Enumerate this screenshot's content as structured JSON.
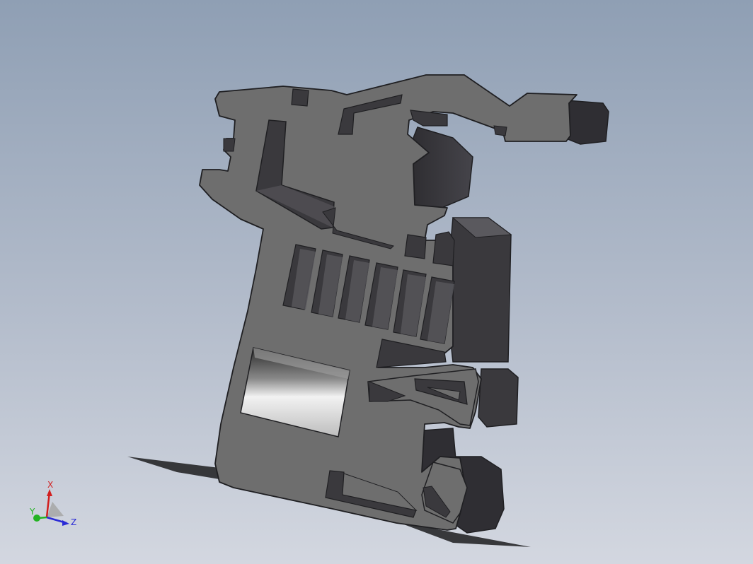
{
  "viewport": {
    "background_top": "#8f9fb4",
    "background_bottom": "#d3d7e0"
  },
  "model": {
    "face_color": "#6e6e6e",
    "side_color": "#3a393d",
    "edge_color": "#1f1f22",
    "icon": "3d-part-model"
  },
  "triad": {
    "x_label": "X",
    "y_label": "Y",
    "z_label": "Z",
    "x_color": "#d21f1f",
    "y_color": "#23b323",
    "z_color": "#2a2ad6",
    "icon": "axis-triad-icon"
  }
}
